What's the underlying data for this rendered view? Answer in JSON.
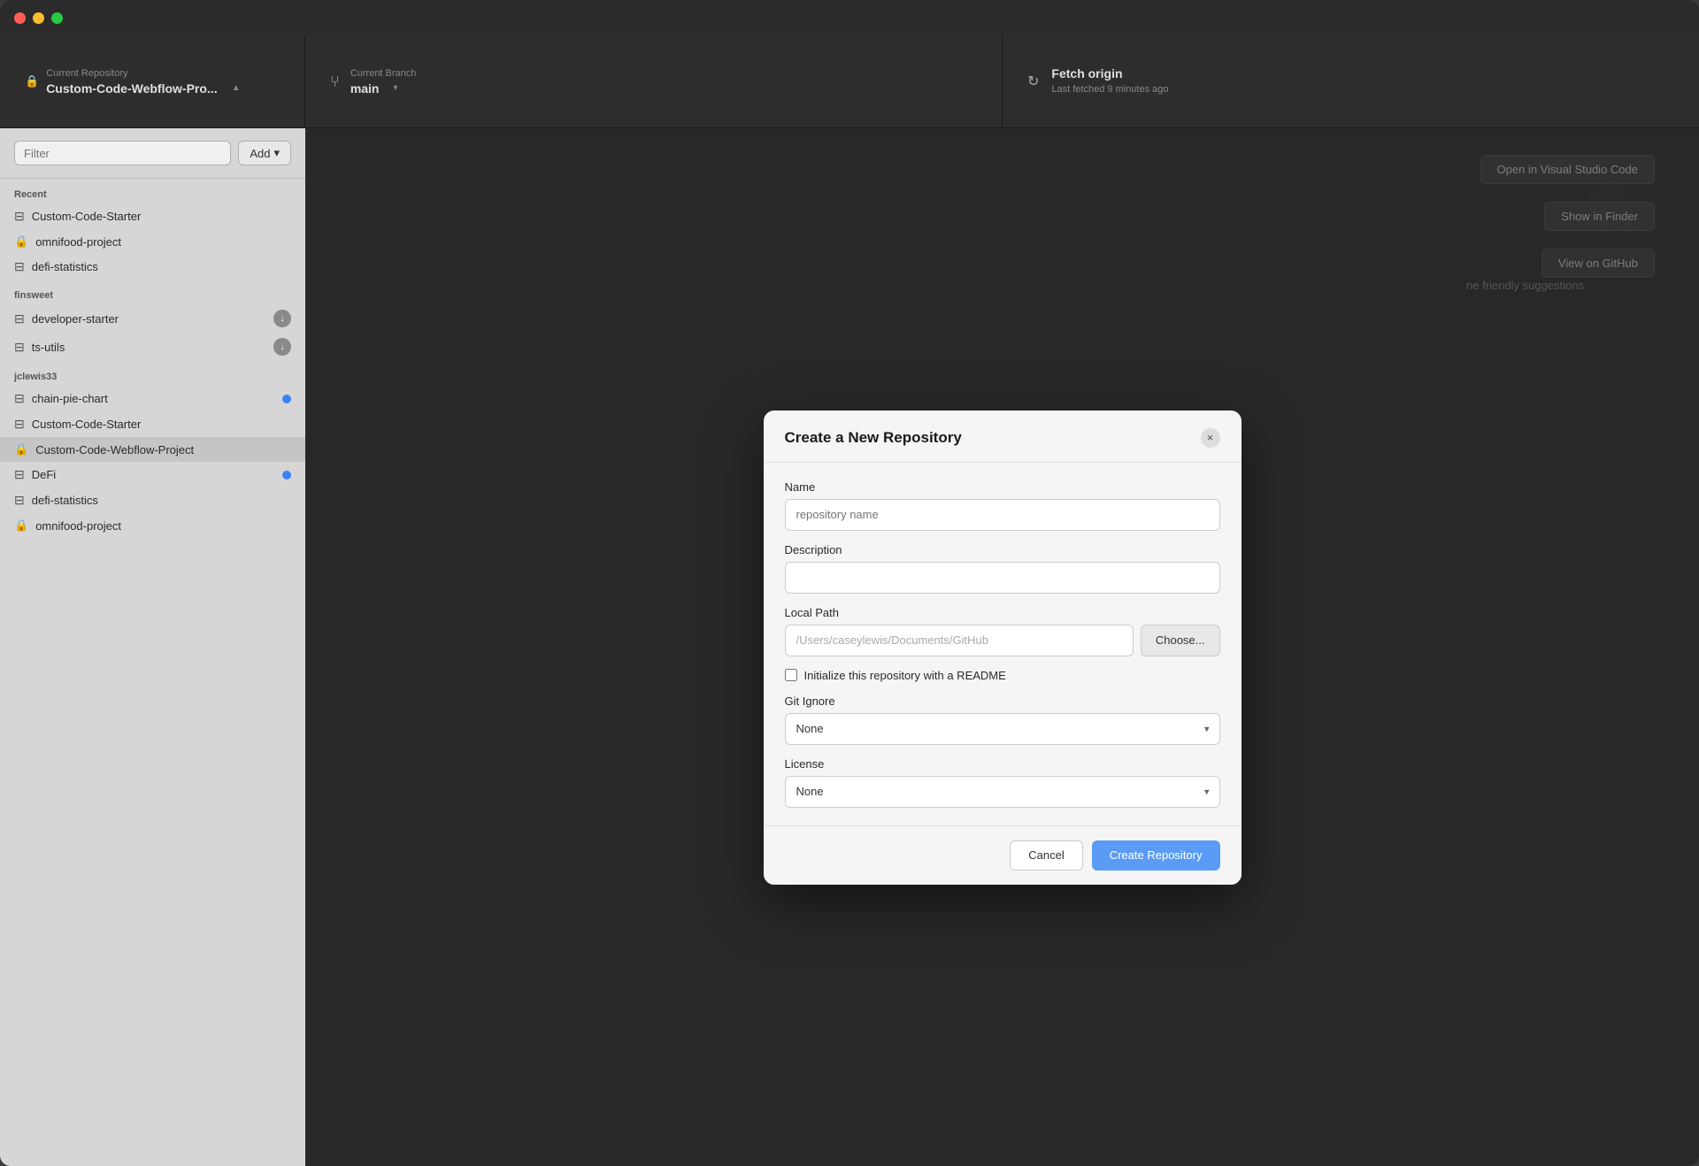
{
  "titlebar": {
    "traffic_lights": [
      "red",
      "yellow",
      "green"
    ]
  },
  "toolbar": {
    "current_repo_label": "Current Repository",
    "current_repo_name": "Custom-Code-Webflow-Pro...",
    "current_branch_label": "Current Branch",
    "current_branch_name": "main",
    "fetch_label": "Fetch origin",
    "fetch_sublabel": "Last fetched 9 minutes ago"
  },
  "sidebar": {
    "filter_placeholder": "Filter",
    "add_button_label": "Add",
    "sections": [
      {
        "title": "Recent",
        "items": [
          {
            "name": "Custom-Code-Starter",
            "type": "public",
            "badge": null
          },
          {
            "name": "omnifood-project",
            "type": "private",
            "badge": null
          },
          {
            "name": "defi-statistics",
            "type": "public",
            "badge": null
          }
        ]
      },
      {
        "title": "finsweet",
        "items": [
          {
            "name": "developer-starter",
            "type": "public",
            "badge": "download"
          },
          {
            "name": "ts-utils",
            "type": "public",
            "badge": "download"
          }
        ]
      },
      {
        "title": "jclewis33",
        "items": [
          {
            "name": "chain-pie-chart",
            "type": "public",
            "badge": "dot"
          },
          {
            "name": "Custom-Code-Starter",
            "type": "public",
            "badge": null
          },
          {
            "name": "Custom-Code-Webflow-Project",
            "type": "private",
            "badge": null
          },
          {
            "name": "DeFi",
            "type": "public",
            "badge": "dot"
          },
          {
            "name": "defi-statistics",
            "type": "public",
            "badge": null
          },
          {
            "name": "omnifood-project",
            "type": "private",
            "badge": null
          }
        ]
      }
    ]
  },
  "content": {
    "suggestions_text": "ne friendly suggestions",
    "btn_vscode": "Open in Visual Studio Code",
    "btn_finder": "Show in Finder",
    "btn_github": "View on GitHub"
  },
  "modal": {
    "title": "Create a New Repository",
    "close_label": "×",
    "name_label": "Name",
    "name_placeholder": "repository name",
    "desc_label": "Description",
    "desc_placeholder": "",
    "path_label": "Local Path",
    "path_value": "/Users/caseylewis/Documents/GitHub",
    "choose_label": "Choose...",
    "readme_label": "Initialize this repository with a README",
    "gitignore_label": "Git Ignore",
    "gitignore_value": "None",
    "gitignore_options": [
      "None"
    ],
    "license_label": "License",
    "license_value": "None",
    "license_options": [
      "None"
    ],
    "cancel_label": "Cancel",
    "create_label": "Create Repository"
  }
}
